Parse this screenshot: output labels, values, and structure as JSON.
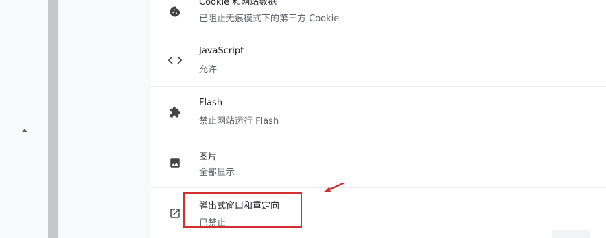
{
  "settings": {
    "rows": [
      {
        "id": "cookies",
        "title": "Cookie 和网站数据",
        "subtitle": "已阻止无痕模式下的第三方 Cookie",
        "icon": "cookie-icon"
      },
      {
        "id": "javascript",
        "title": "JavaScript",
        "subtitle": "允许",
        "icon": "code-icon"
      },
      {
        "id": "flash",
        "title": "Flash",
        "subtitle": "禁止网站运行 Flash",
        "icon": "puzzle-icon"
      },
      {
        "id": "images",
        "title": "图片",
        "subtitle": "全部显示",
        "icon": "image-icon"
      },
      {
        "id": "popups",
        "title": "弹出式窗口和重定向",
        "subtitle": "已禁止",
        "icon": "open-in-new-icon"
      }
    ]
  },
  "colors": {
    "annotation": "#d32f2f",
    "icon": "#444444",
    "title": "#202124",
    "subtitle": "#5f6368"
  }
}
